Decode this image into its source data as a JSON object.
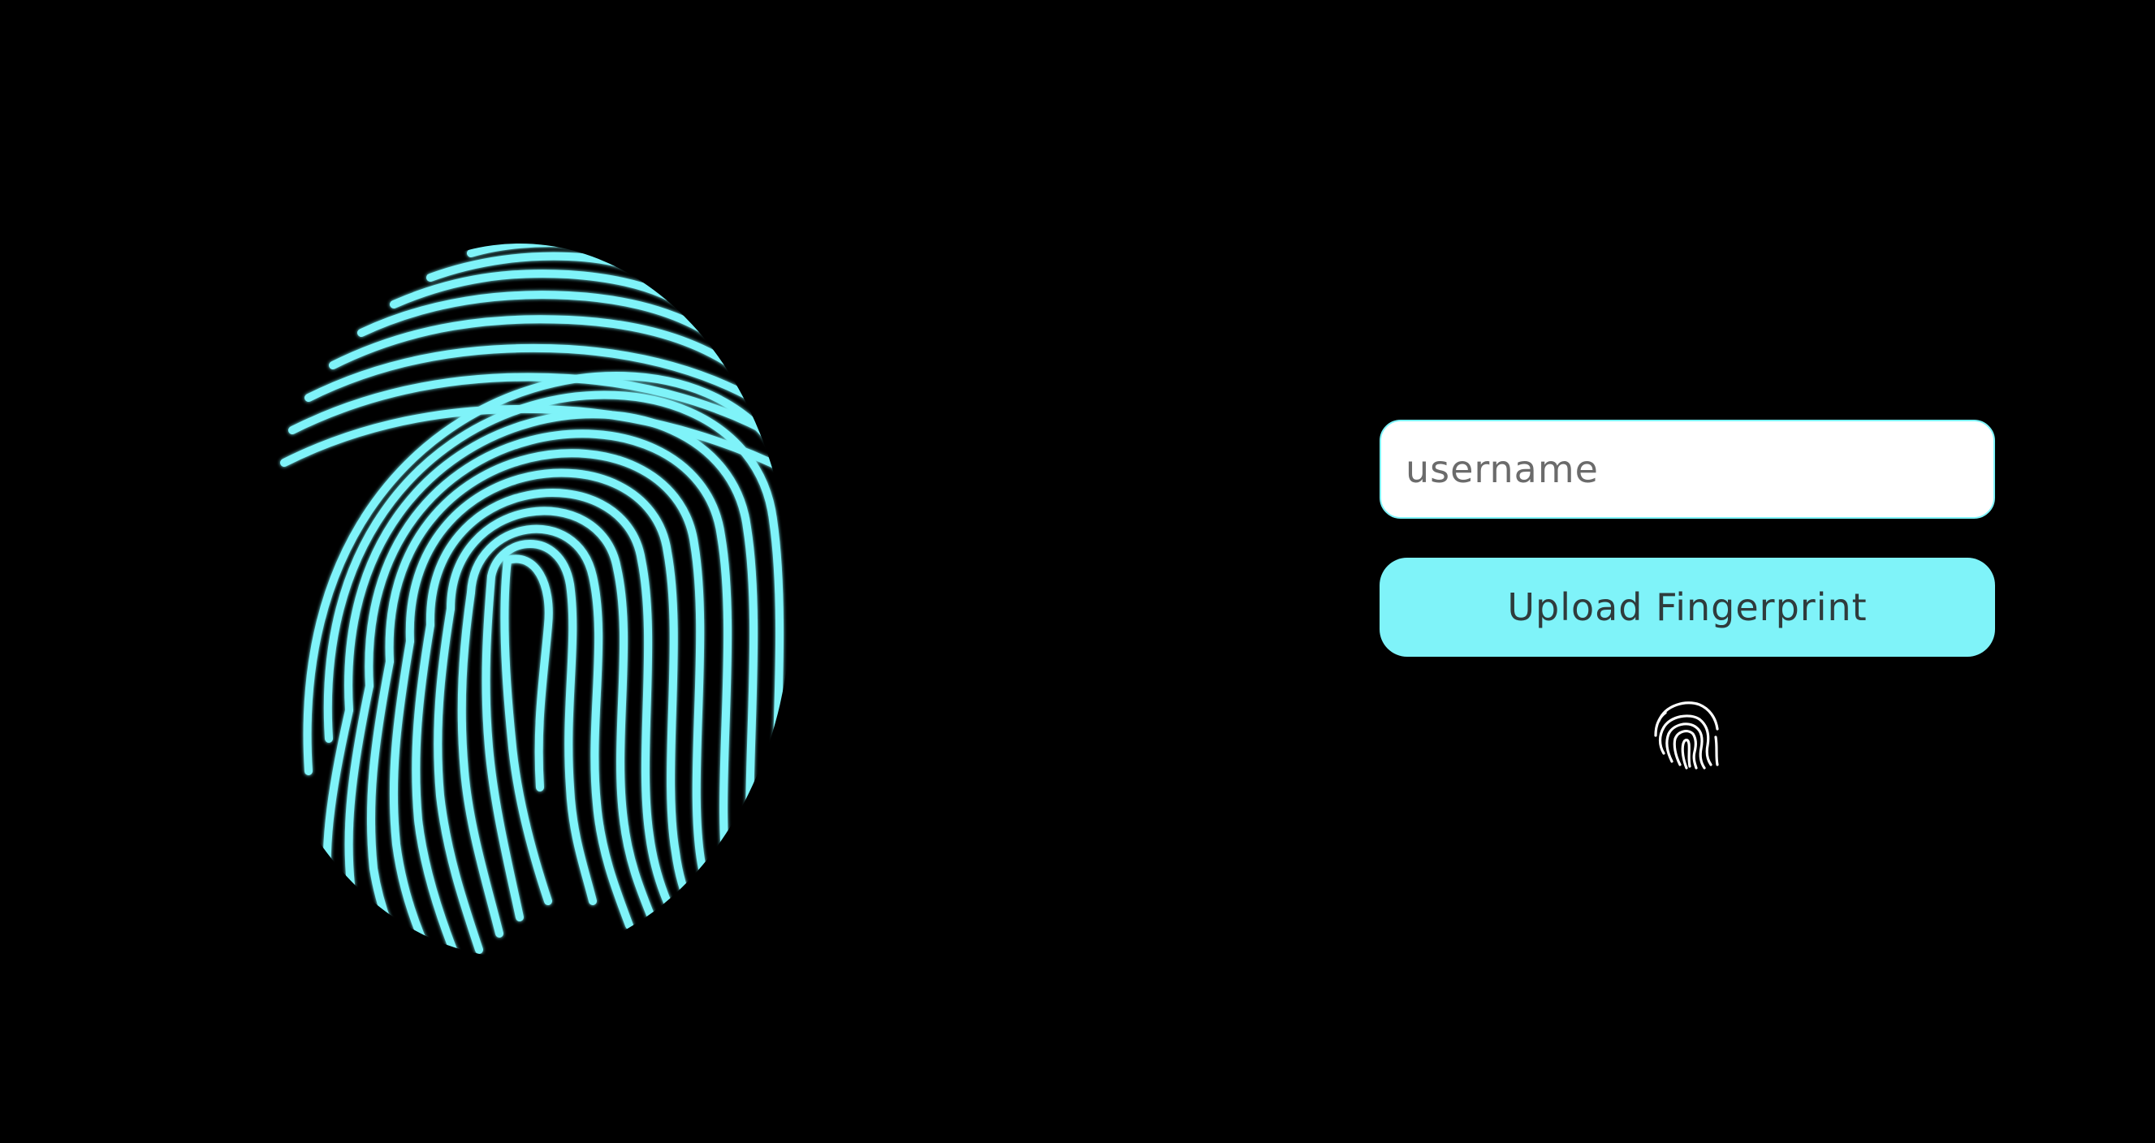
{
  "login": {
    "username_placeholder": "username",
    "username_value": "",
    "upload_label": "Upload Fingerprint"
  },
  "icons": {
    "hero": "fingerprint-icon",
    "button_hint": "fingerprint-icon"
  },
  "colors": {
    "background": "#000000",
    "accent": "#7ff3f9",
    "field_background": "#ffffff",
    "button_text": "#2f3b3c"
  }
}
